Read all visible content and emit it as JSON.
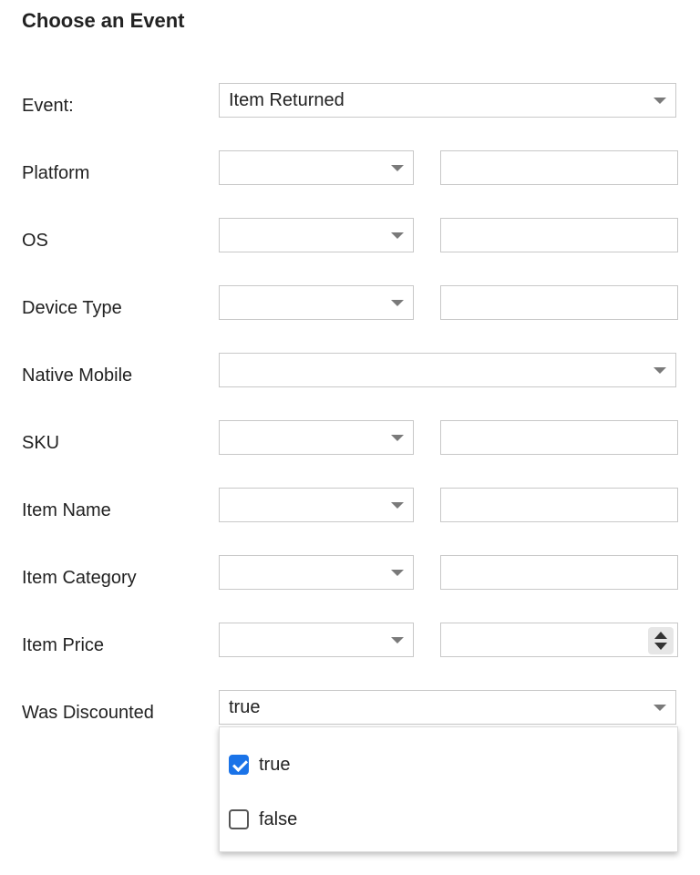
{
  "page_title": "Choose an Event",
  "event": {
    "label": "Event:",
    "value": "Item Returned"
  },
  "filters": [
    {
      "label": "Platform"
    },
    {
      "label": "OS"
    },
    {
      "label": "Device Type"
    },
    {
      "label": "Native Mobile"
    },
    {
      "label": "SKU"
    },
    {
      "label": "Item Name"
    },
    {
      "label": "Item Category"
    },
    {
      "label": "Item Price"
    },
    {
      "label": "Was Discounted",
      "value": "true"
    }
  ],
  "discount_dropdown": {
    "options": [
      {
        "label": "true",
        "checked": true
      },
      {
        "label": "false",
        "checked": false
      }
    ]
  },
  "colors": {
    "accent": "#1a73e8",
    "border": "#c8c8c8",
    "text": "#222222"
  },
  "icons": {
    "select_caret": "chevron-down-icon",
    "number_spinner": "spinner-arrows-icon",
    "option_check": "checkbox-icon"
  }
}
